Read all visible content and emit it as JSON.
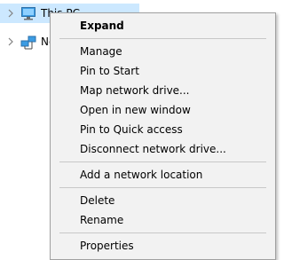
{
  "navigation_tree": {
    "items": [
      {
        "label": "This PC",
        "icon": "computer-icon",
        "selected": true
      },
      {
        "label": "Network",
        "icon": "network-icon",
        "selected": false
      }
    ]
  },
  "context_menu": {
    "groups": [
      [
        {
          "label": "Expand",
          "bold": true
        }
      ],
      [
        {
          "label": "Manage"
        },
        {
          "label": "Pin to Start"
        },
        {
          "label": "Map network drive..."
        },
        {
          "label": "Open in new window"
        },
        {
          "label": "Pin to Quick access"
        },
        {
          "label": "Disconnect network drive..."
        }
      ],
      [
        {
          "label": "Add a network location"
        }
      ],
      [
        {
          "label": "Delete"
        },
        {
          "label": "Rename"
        }
      ],
      [
        {
          "label": "Properties"
        }
      ]
    ]
  },
  "colors": {
    "selection": "#cce8ff",
    "menu_background": "#f2f2f2",
    "menu_border": "#a0a0a0",
    "separator": "#c8c8c8"
  }
}
